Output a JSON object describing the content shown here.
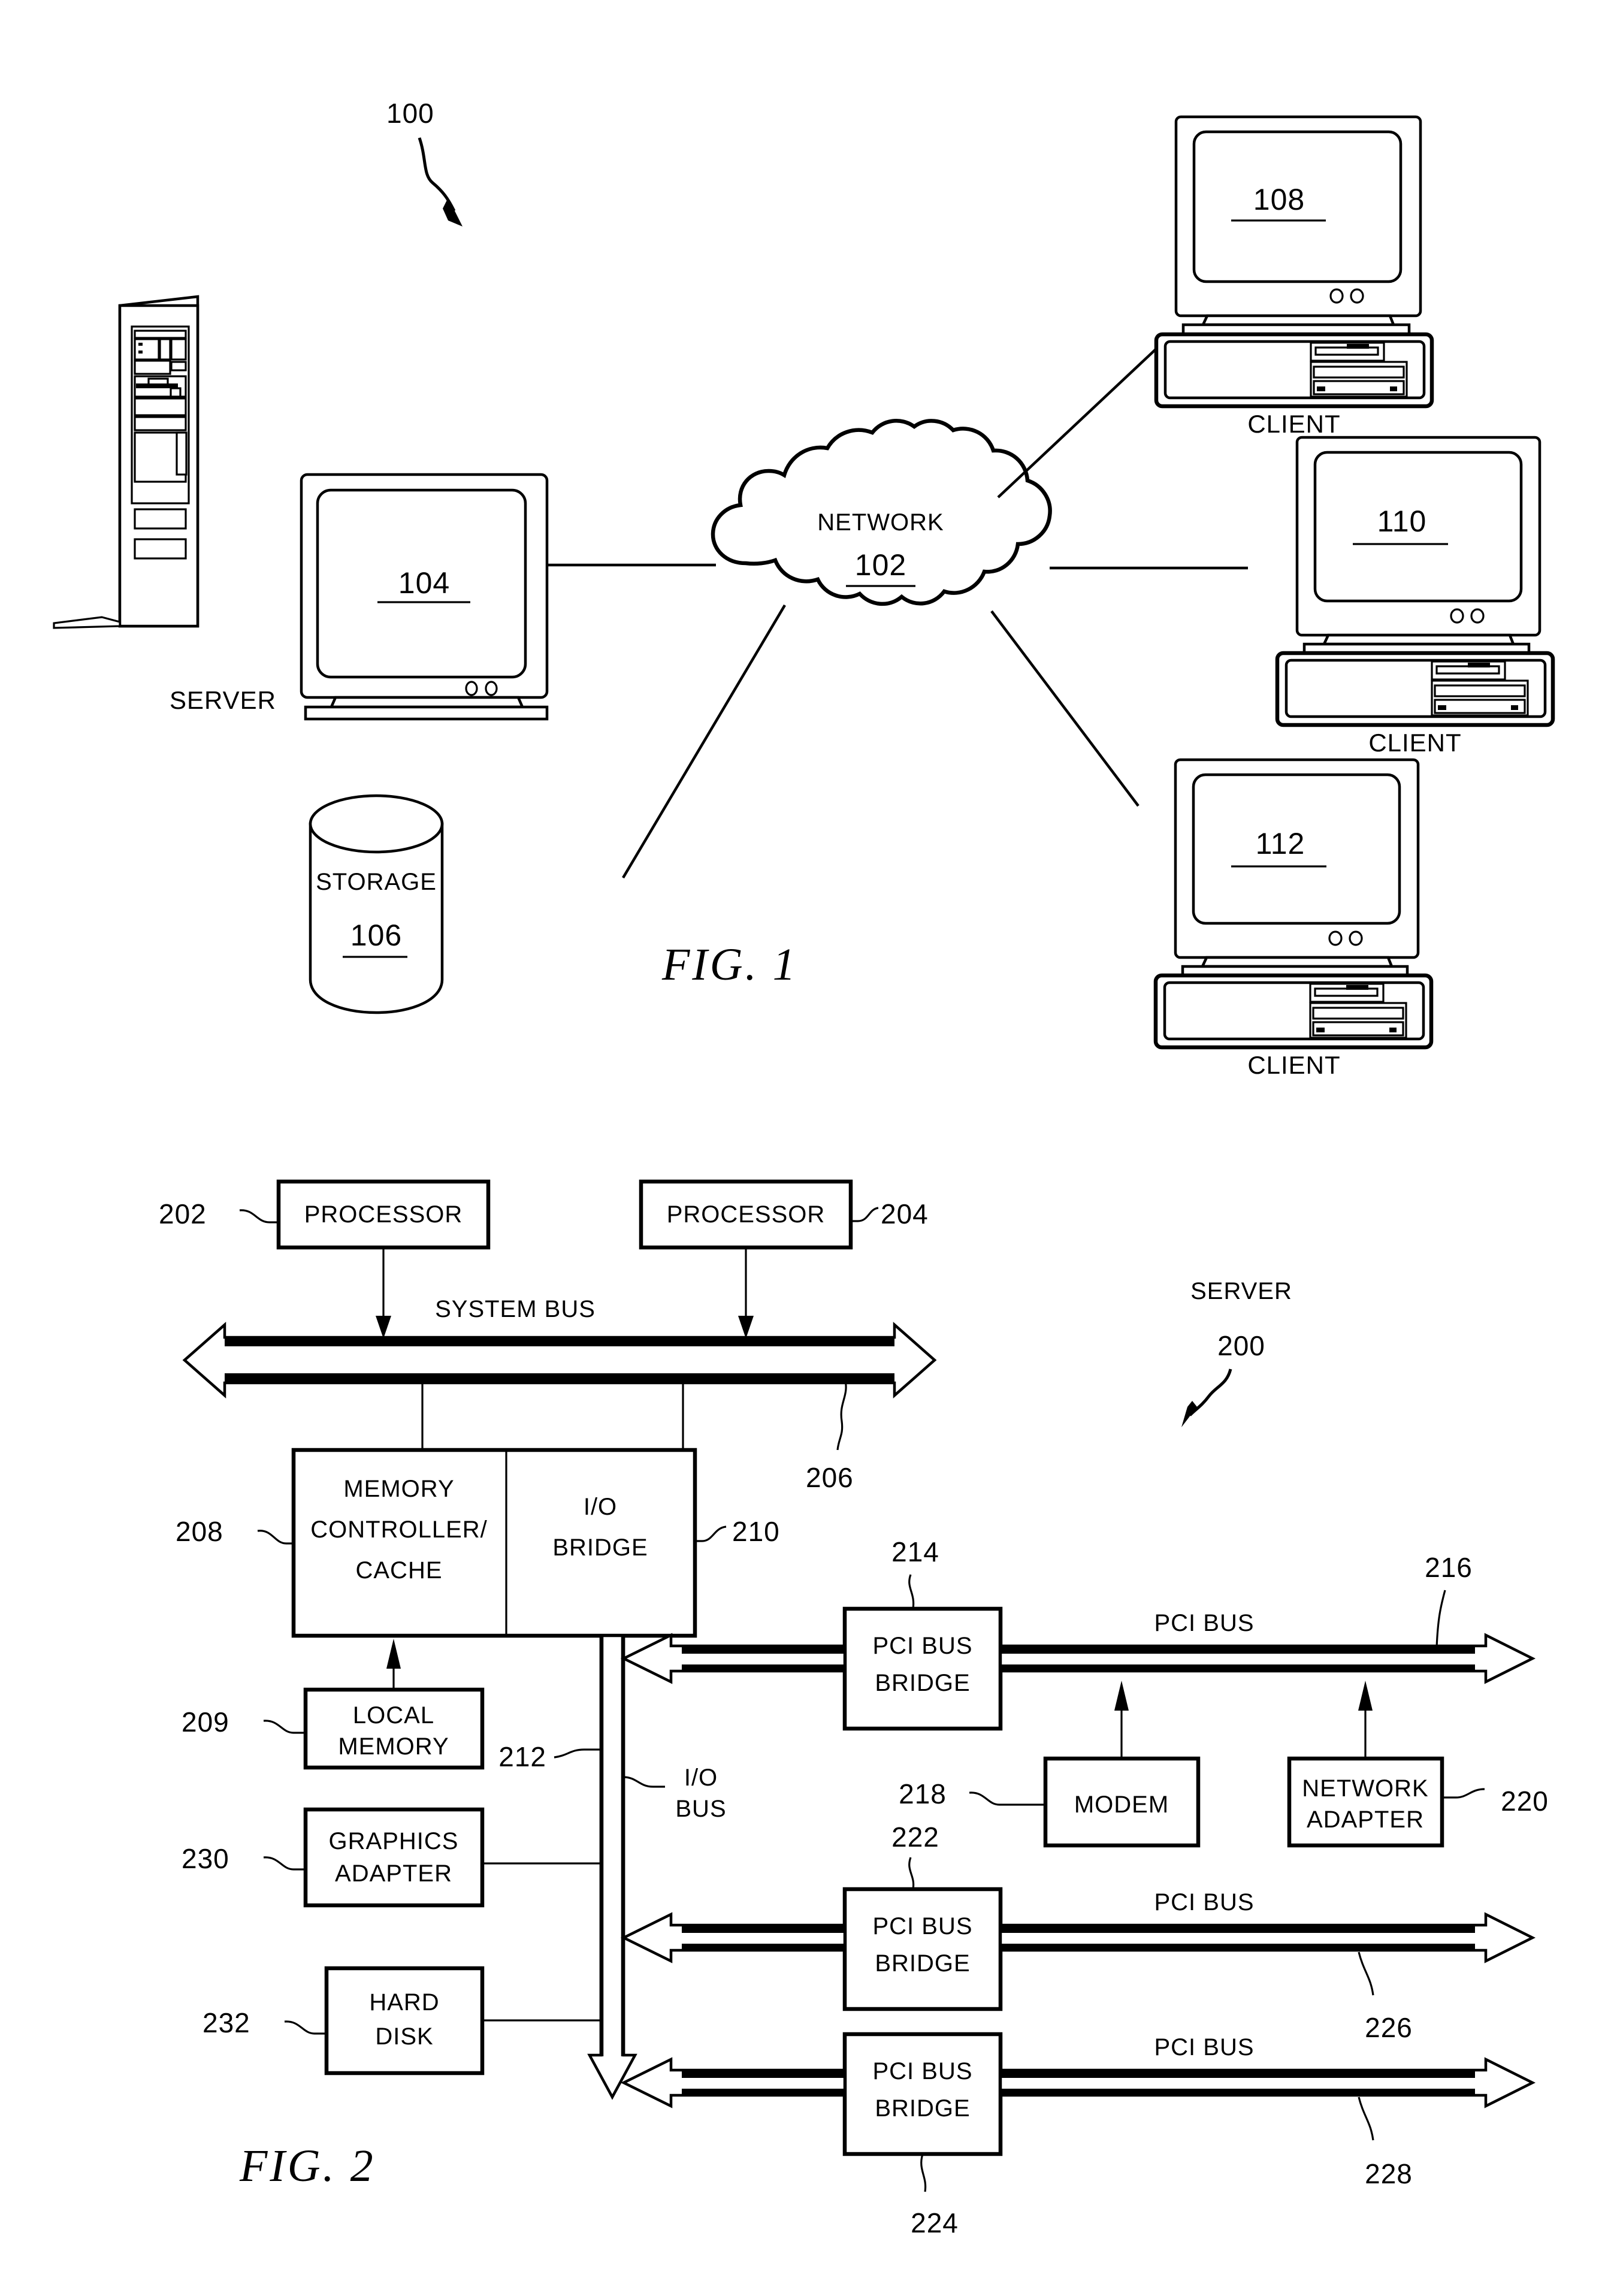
{
  "document": {
    "type": "patent-figure-sheet",
    "figures": [
      "FIG. 1",
      "FIG. 2"
    ]
  },
  "figure1": {
    "caption": "FIG.  1",
    "system_ref": "100",
    "network": {
      "label": "NETWORK",
      "ref": "102",
      "shape": "cloud-icon"
    },
    "server": {
      "caption": "SERVER",
      "monitor_ref": "104",
      "tower": "server-tower-icon"
    },
    "storage": {
      "label": "STORAGE",
      "ref": "106",
      "shape": "cylinder-icon"
    },
    "clients": [
      {
        "ref": "108",
        "caption": "CLIENT"
      },
      {
        "ref": "110",
        "caption": "CLIENT"
      },
      {
        "ref": "112",
        "caption": "CLIENT"
      }
    ]
  },
  "figure2": {
    "caption": "FIG.  2",
    "system_title": "SERVER",
    "system_ref": "200",
    "processors": [
      {
        "label": "PROCESSOR",
        "ref": "202"
      },
      {
        "label": "PROCESSOR",
        "ref": "204"
      }
    ],
    "system_bus": {
      "label": "SYSTEM  BUS",
      "ref": "206"
    },
    "memory_controller": {
      "line1": "MEMORY",
      "line2": "CONTROLLER/",
      "line3": "CACHE",
      "ref": "208"
    },
    "io_bridge": {
      "line1": "I/O",
      "line2": "BRIDGE",
      "ref": "210"
    },
    "local_memory": {
      "line1": "LOCAL",
      "line2": "MEMORY",
      "ref": "209"
    },
    "io_bus": {
      "line1": "I/O",
      "line2": "BUS",
      "ref": "212"
    },
    "graphics_adapter": {
      "line1": "GRAPHICS",
      "line2": "ADAPTER",
      "ref": "230"
    },
    "hard_disk": {
      "line1": "HARD",
      "line2": "DISK",
      "ref": "232"
    },
    "pci_bridges": [
      {
        "line1": "PCI  BUS",
        "line2": "BRIDGE",
        "ref": "214",
        "bus_label": "PCI  BUS",
        "bus_ref": "216"
      },
      {
        "line1": "PCI  BUS",
        "line2": "BRIDGE",
        "ref": "222",
        "bus_label": "PCI  BUS",
        "bus_ref": "226"
      },
      {
        "line1": "PCI  BUS",
        "line2": "BRIDGE",
        "ref": "224",
        "bus_label": "PCI  BUS",
        "bus_ref": "228"
      }
    ],
    "modem": {
      "label": "MODEM",
      "ref": "218"
    },
    "network_adapter": {
      "line1": "NETWORK",
      "line2": "ADAPTER",
      "ref": "220"
    }
  },
  "colors": {
    "ink": "#000000",
    "paper": "#ffffff"
  }
}
